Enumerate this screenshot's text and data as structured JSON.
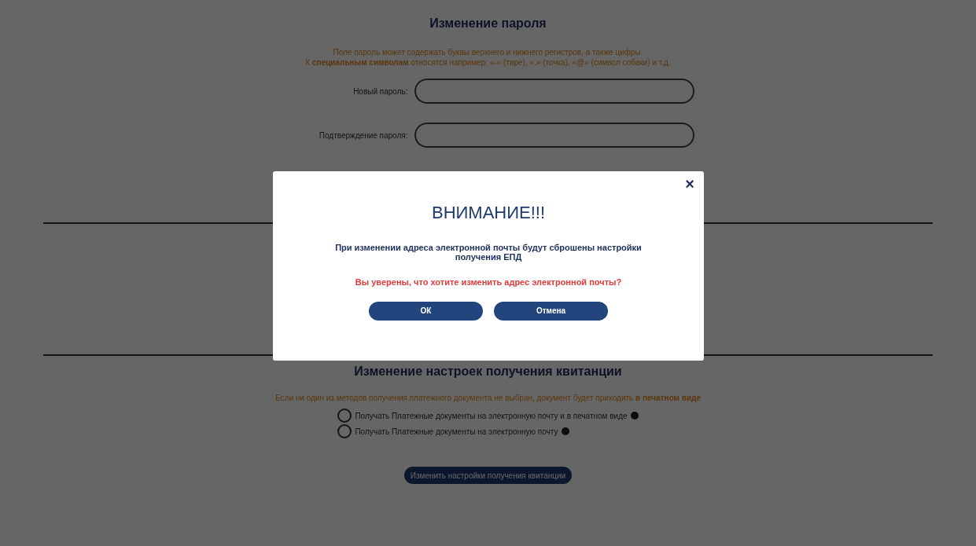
{
  "password_section": {
    "title": "Изменение пароля",
    "hint_lines": [
      "Поле пароль может содержать буквы верхнего и нижнего регистров, а также цифры.",
      "К **специальным символам** относятся например: «-» (тире), «.» (точка), «@» (символ собаки) и т.д."
    ],
    "fields": [
      {
        "label": "Новый пароль:"
      },
      {
        "label": "Подтверждение пароля:"
      }
    ]
  },
  "receipt_section": {
    "title": "Изменение настроек получения квитанции",
    "hint": "Если ни один из методов получения платежного документа не выбран, документ будет приходить **в печатном виде**",
    "options": [
      {
        "label": "Получать Платежные документы на электронную почту и в печатном виде",
        "selected": false
      },
      {
        "label": "Получать Платежные документы на электронную почту",
        "selected": false
      }
    ],
    "submit": "Изменить настройки получения квитанции"
  },
  "modal": {
    "title": "ВНИМАНИЕ!!!",
    "close": "×",
    "message": "При изменении адреса электронной почты будут сброшены настройки получения ЕПД",
    "question": "Вы уверены, что хотите изменить адрес электронной почты?",
    "buttons": [
      "ОК",
      "Отмена"
    ]
  }
}
